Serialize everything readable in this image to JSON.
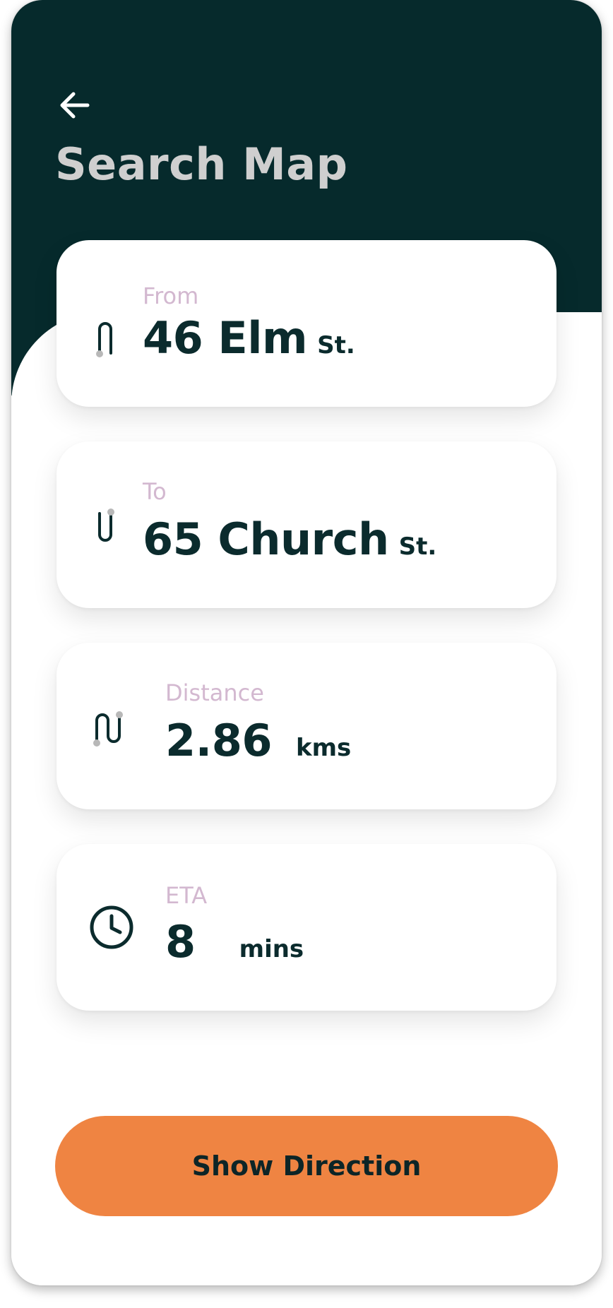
{
  "header": {
    "title": "Search Map",
    "back_icon": "arrow-left-icon"
  },
  "route": {
    "from": {
      "label": "From",
      "value": "46 Elm",
      "unit": "St.",
      "icon": "route-start-icon"
    },
    "to": {
      "label": "To",
      "value": "65 Church",
      "unit": "St.",
      "icon": "route-end-icon"
    },
    "distance": {
      "label": "Distance",
      "value": "2.86",
      "unit": "kms",
      "icon": "route-path-icon"
    },
    "eta": {
      "label": "ETA",
      "value": "8",
      "unit": "mins",
      "icon": "clock-icon"
    }
  },
  "actions": {
    "show_direction_label": "Show Direction"
  },
  "colors": {
    "header_bg": "#062a2c",
    "title_text": "#cfcfcf",
    "label_text": "#d3b8d0",
    "value_text": "#0b2b2d",
    "accent": "#ef8442"
  }
}
